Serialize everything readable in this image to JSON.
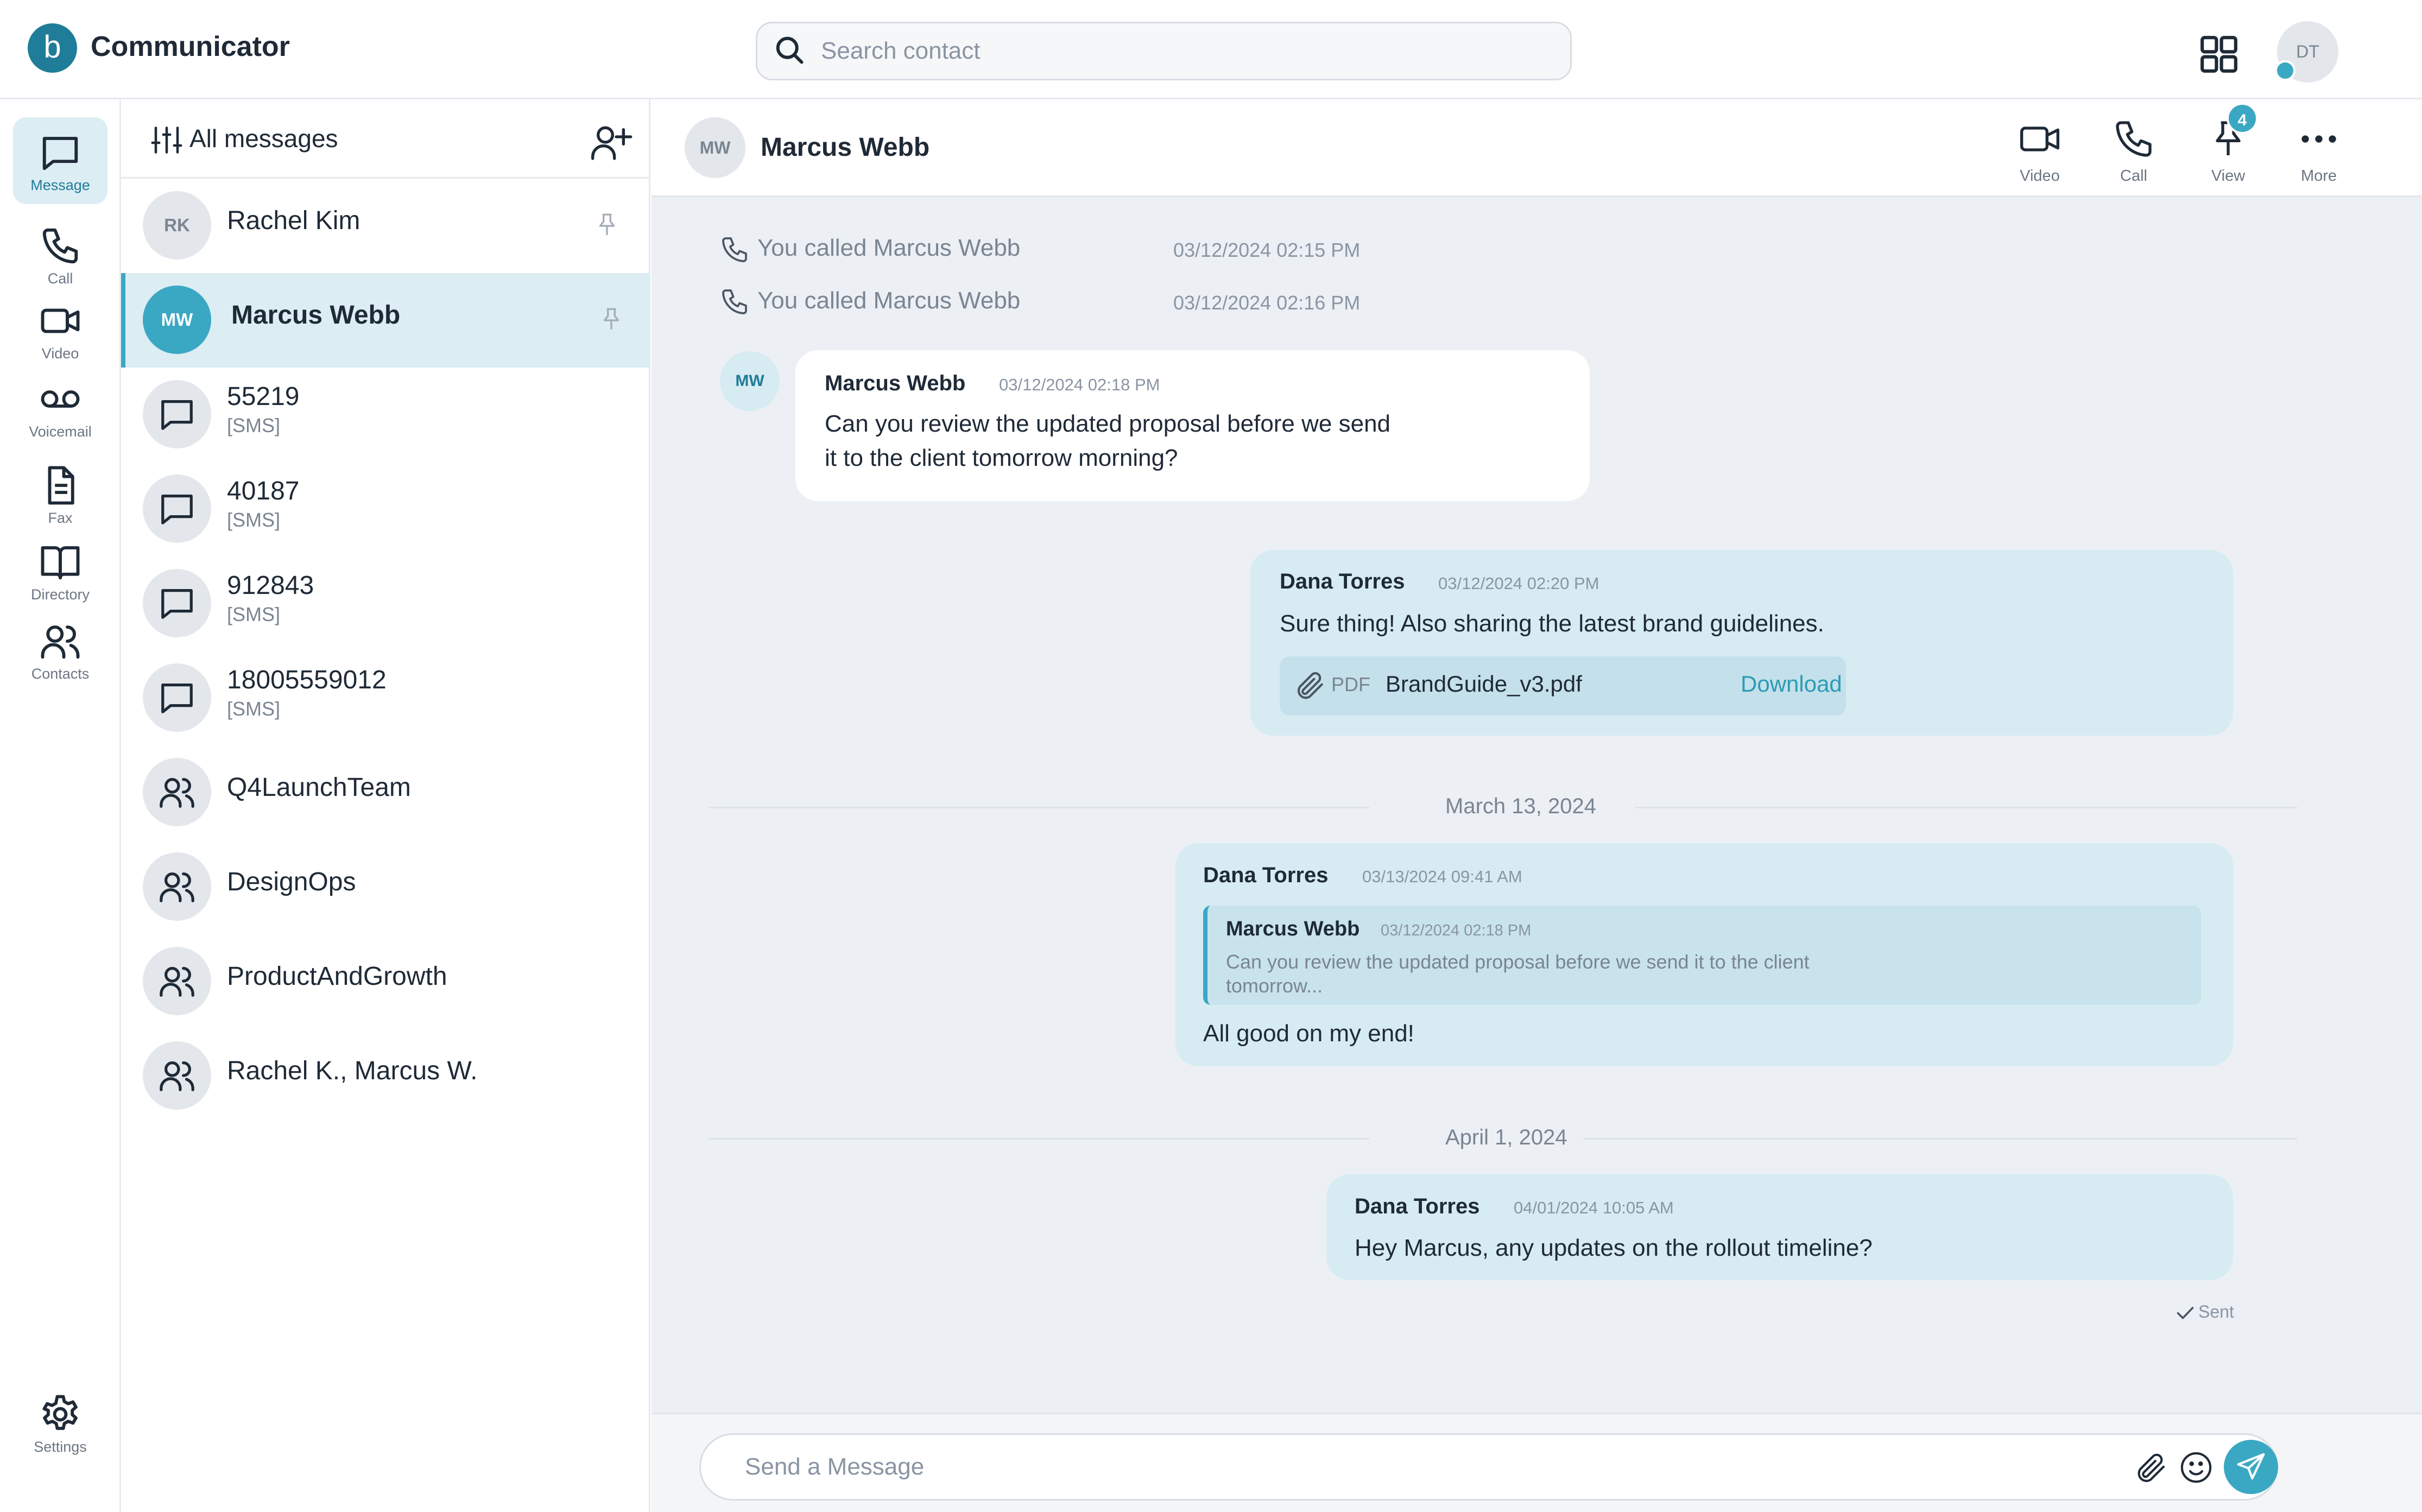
{
  "app": {
    "title": "Communicator",
    "logo_letter": "b"
  },
  "search": {
    "placeholder": "Search contact"
  },
  "user": {
    "initials": "DT"
  },
  "rail": {
    "items": [
      {
        "label": "Message",
        "icon": "message-icon"
      },
      {
        "label": "Call",
        "icon": "phone-icon"
      },
      {
        "label": "Video",
        "icon": "video-icon"
      },
      {
        "label": "Voicemail",
        "icon": "voicemail-icon"
      },
      {
        "label": "Fax",
        "icon": "fax-icon"
      },
      {
        "label": "Directory",
        "icon": "book-icon"
      },
      {
        "label": "Contacts",
        "icon": "contacts-icon"
      }
    ],
    "settings": {
      "label": "Settings",
      "icon": "gear-icon"
    }
  },
  "list": {
    "filter_label": "All messages",
    "conversations": [
      {
        "name": "Rachel Kim",
        "initials": "RK",
        "pinned": true
      },
      {
        "name": "Marcus Webb",
        "initials": "MW",
        "pinned": true,
        "active": true
      },
      {
        "name": "55219",
        "sub": "[SMS]"
      },
      {
        "name": "40187",
        "sub": "[SMS]"
      },
      {
        "name": "912843",
        "sub": "[SMS]"
      },
      {
        "name": "18005559012",
        "sub": "[SMS]"
      },
      {
        "name": "Q4LaunchTeam"
      },
      {
        "name": "DesignOps"
      },
      {
        "name": "ProductAndGrowth"
      },
      {
        "name": "Rachel K., Marcus W."
      }
    ]
  },
  "chat": {
    "contact_name": "Marcus Webb",
    "contact_initials": "MW",
    "actions": [
      {
        "label": "Video",
        "icon": "video-icon"
      },
      {
        "label": "Call",
        "icon": "phone-icon"
      },
      {
        "label": "View",
        "icon": "pin-icon",
        "badge": "4"
      },
      {
        "label": "More",
        "icon": "more-icon"
      }
    ],
    "calls": [
      {
        "text": "You called Marcus Webb",
        "time": "03/12/2024 02:15 PM"
      },
      {
        "text": "You called Marcus Webb",
        "time": "03/12/2024 02:16 PM"
      }
    ],
    "messages": [
      {
        "sender": "Marcus Webb",
        "initials": "MW",
        "time": "03/12/2024 02:18 PM",
        "lines": [
          "Can you review the updated proposal before we send",
          "it to the client tomorrow morning?"
        ]
      },
      {
        "sender": "Dana Torres",
        "time": "03/12/2024 02:20 PM",
        "text": "Sure thing! Also sharing the latest brand guidelines.",
        "attachment": {
          "type": "PDF",
          "name": "BrandGuide_v3.pdf",
          "action": "Download"
        }
      },
      {
        "date_separator": "March 13, 2024",
        "sender": "Dana Torres",
        "time": "03/13/2024 09:41 AM",
        "quote": {
          "sender": "Marcus Webb",
          "time": "03/12/2024 02:18 PM",
          "text": "Can you review the updated proposal before we send it to the client tomorrow..."
        },
        "text": "All good on my end!"
      },
      {
        "date_separator": "April 1, 2024",
        "sender": "Dana Torres",
        "time": "04/01/2024 10:05 AM",
        "text": "Hey Marcus, any updates on the rollout timeline?",
        "status": "Sent"
      }
    ]
  },
  "composer": {
    "placeholder": "Send a Message"
  },
  "colors": {
    "accent": "#3aa8c3",
    "brand": "#1f7d99",
    "outgoing_bubble": "#d7ebf2",
    "chat_bg": "#ecf0f5"
  }
}
